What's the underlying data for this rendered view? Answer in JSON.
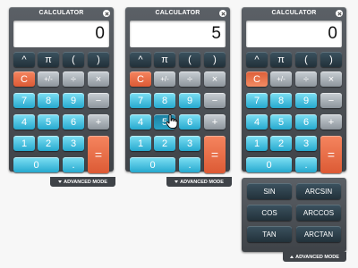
{
  "title": "CALCULATOR",
  "advanced_label": "ADVANCED MODE",
  "calculators": [
    {
      "display": "0"
    },
    {
      "display": "5"
    },
    {
      "display": "0"
    }
  ],
  "keys": {
    "caret": "^",
    "pi": "π",
    "lparen": "(",
    "rparen": ")",
    "clear": "C",
    "plusminus": "+/-",
    "divide": "÷",
    "multiply": "×",
    "minus": "−",
    "plus": "+",
    "equals": "=",
    "dot": ".",
    "d0": "0",
    "d1": "1",
    "d2": "2",
    "d3": "3",
    "d4": "4",
    "d5": "5",
    "d6": "6",
    "d7": "7",
    "d8": "8",
    "d9": "9"
  },
  "advanced": {
    "sin": "SIN",
    "arcsin": "ARCSIN",
    "cos": "COS",
    "arccos": "ARCCOS",
    "tan": "TAN",
    "arctan": "ARCTAN"
  },
  "colors": {
    "dark": "#2e404b",
    "digit": "#4cc6e6",
    "operator": "#a9b0b6",
    "accent": "#ec6b44"
  }
}
